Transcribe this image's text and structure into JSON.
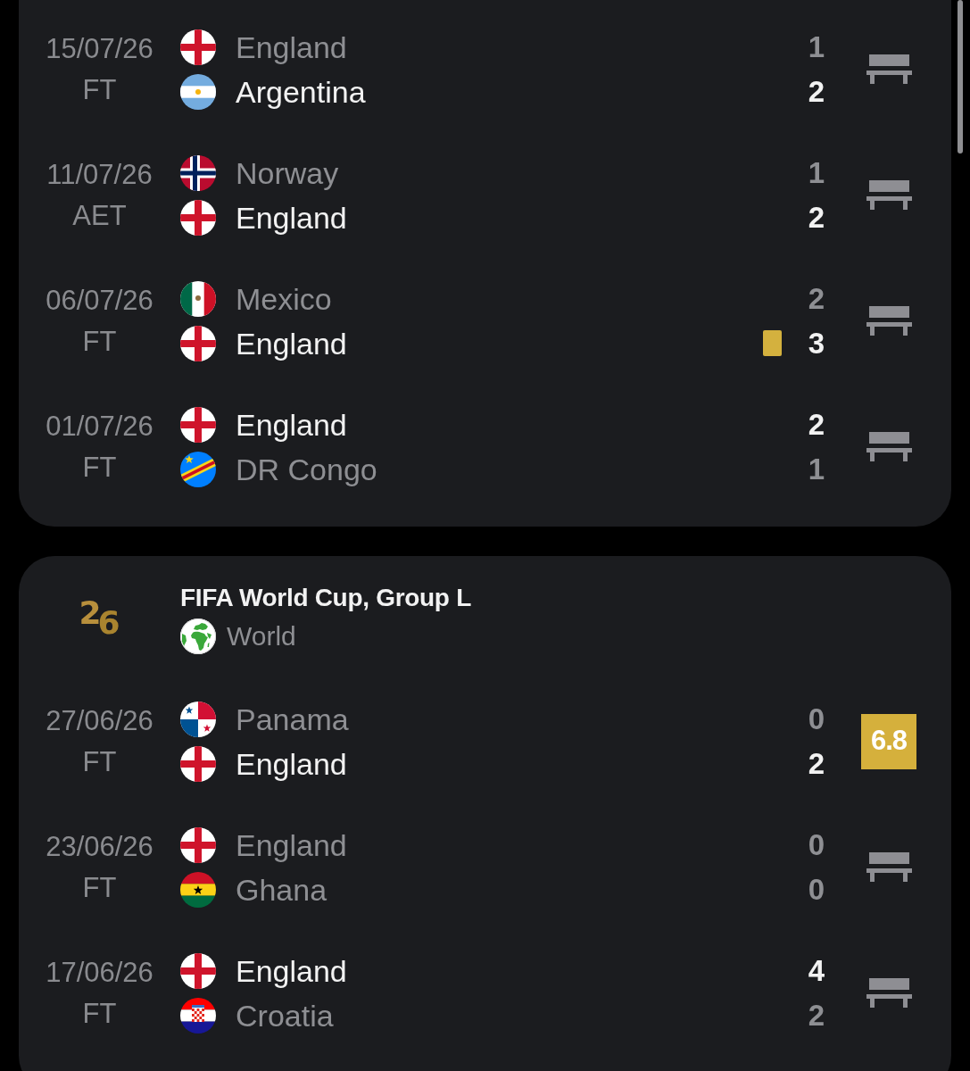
{
  "cards": [
    {
      "matches": [
        {
          "date": "15/07/26",
          "status": "FT",
          "teams": [
            {
              "name": "England",
              "kind": "england",
              "score": "1",
              "winner": false,
              "yellow_card": false
            },
            {
              "name": "Argentina",
              "kind": "argentina",
              "score": "2",
              "winner": true,
              "yellow_card": false
            }
          ],
          "player": {
            "kind": "bench"
          }
        },
        {
          "date": "11/07/26",
          "status": "AET",
          "teams": [
            {
              "name": "Norway",
              "kind": "norway",
              "score": "1",
              "winner": false,
              "yellow_card": false
            },
            {
              "name": "England",
              "kind": "england",
              "score": "2",
              "winner": true,
              "yellow_card": false
            }
          ],
          "player": {
            "kind": "bench"
          }
        },
        {
          "date": "06/07/26",
          "status": "FT",
          "teams": [
            {
              "name": "Mexico",
              "kind": "mexico",
              "score": "2",
              "winner": false,
              "yellow_card": false
            },
            {
              "name": "England",
              "kind": "england",
              "score": "3",
              "winner": true,
              "yellow_card": true
            }
          ],
          "player": {
            "kind": "bench"
          }
        },
        {
          "date": "01/07/26",
          "status": "FT",
          "teams": [
            {
              "name": "England",
              "kind": "england",
              "score": "2",
              "winner": true,
              "yellow_card": false
            },
            {
              "name": "DR Congo",
              "kind": "drcongo",
              "score": "1",
              "winner": false,
              "yellow_card": false
            }
          ],
          "player": {
            "kind": "bench"
          }
        }
      ]
    },
    {
      "header": {
        "logo": "26",
        "title": "FIFA World Cup, Group L",
        "region": "World"
      },
      "matches": [
        {
          "date": "27/06/26",
          "status": "FT",
          "teams": [
            {
              "name": "Panama",
              "kind": "panama",
              "score": "0",
              "winner": false,
              "yellow_card": false
            },
            {
              "name": "England",
              "kind": "england",
              "score": "2",
              "winner": true,
              "yellow_card": false
            }
          ],
          "player": {
            "kind": "rating",
            "rating": "6.8"
          }
        },
        {
          "date": "23/06/26",
          "status": "FT",
          "teams": [
            {
              "name": "England",
              "kind": "england",
              "score": "0",
              "winner": false,
              "yellow_card": false
            },
            {
              "name": "Ghana",
              "kind": "ghana",
              "score": "0",
              "winner": false,
              "yellow_card": false
            }
          ],
          "player": {
            "kind": "bench"
          }
        },
        {
          "date": "17/06/26",
          "status": "FT",
          "teams": [
            {
              "name": "England",
              "kind": "england",
              "score": "4",
              "winner": true,
              "yellow_card": false
            },
            {
              "name": "Croatia",
              "kind": "croatia",
              "score": "2",
              "winner": false,
              "yellow_card": false
            }
          ],
          "player": {
            "kind": "bench"
          }
        }
      ]
    }
  ]
}
